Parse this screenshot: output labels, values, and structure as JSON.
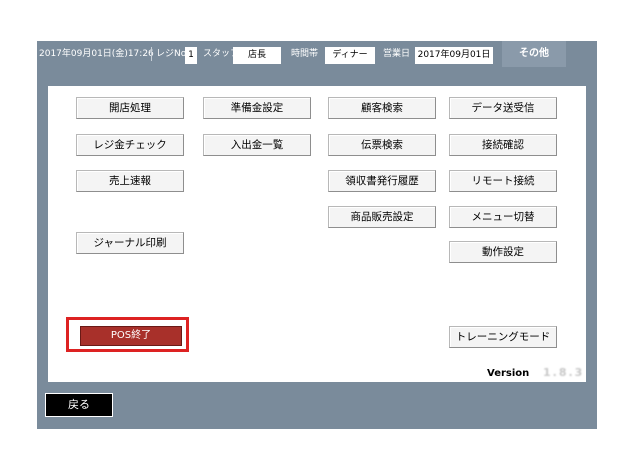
{
  "header": {
    "datetime": "2017年09月01日(金)17:26",
    "register_label": "レジNo",
    "register_no": "1",
    "staff_label": "スタッフ",
    "staff_value": "店長",
    "time_slot_label": "時間帯",
    "time_slot_value": "ディナー",
    "business_day_label": "営業日",
    "business_day_value": "2017年09月01日",
    "other_label": "その他"
  },
  "buttons": {
    "open_store": "開店処理",
    "reserve_setting": "準備金設定",
    "customer_search": "顧客検索",
    "data_transfer": "データ送受信",
    "register_check": "レジ金チェック",
    "deposit_list": "入出金一覧",
    "slip_search": "伝票検索",
    "connection_check": "接続確認",
    "sales_flash": "売上速報",
    "receipt_history": "領収書発行履歴",
    "remote_connection": "リモート接続",
    "product_sales_setting": "商品販売設定",
    "menu_switch": "メニュー切替",
    "journal_print": "ジャーナル印刷",
    "operation_setting": "動作設定",
    "pos_exit": "POS終了",
    "training_mode": "トレーニングモード"
  },
  "footer": {
    "version_label": "Version",
    "version_value": "1.8.3",
    "back_label": "戻る"
  },
  "colors": {
    "frame": "#7a8b9b",
    "exit_button": "#a8302a",
    "highlight_border": "#dd2222"
  }
}
